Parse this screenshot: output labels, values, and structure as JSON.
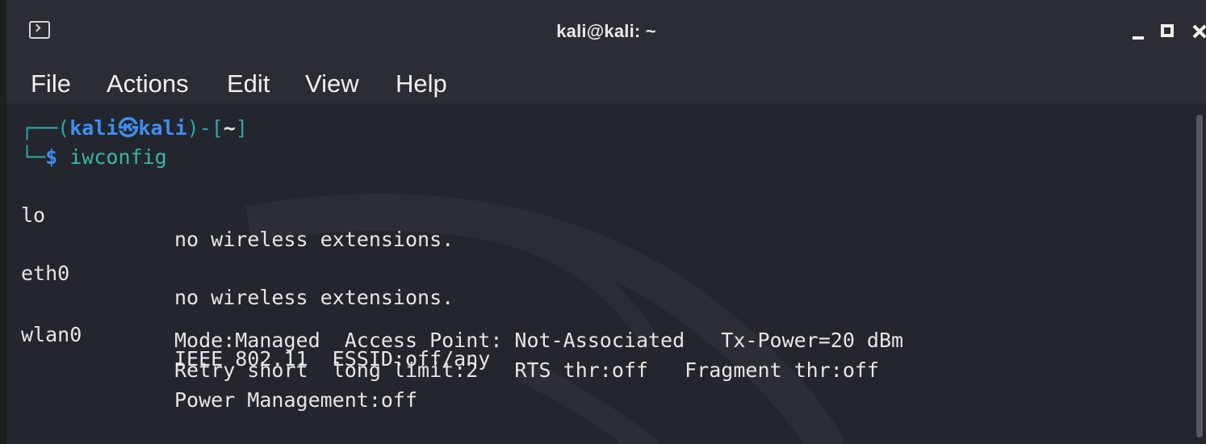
{
  "window": {
    "title": "kali@kali: ~",
    "icon": "terminal-icon"
  },
  "menu": {
    "items": [
      "File",
      "Actions",
      "Edit",
      "View",
      "Help"
    ]
  },
  "prompt": {
    "open": "┌──(",
    "user_host": "kali㉿kali",
    "sep": ")-[",
    "dir": "~",
    "close": "]",
    "corner": "└─",
    "dollar": "$",
    "command": "iwconfig"
  },
  "output": {
    "lo": {
      "iface": "lo",
      "text": "no wireless extensions."
    },
    "eth0": {
      "iface": "eth0",
      "text": "no wireless extensions."
    },
    "wlan0": {
      "iface": "wlan0",
      "lines": [
        "IEEE 802.11  ESSID:off/any",
        "Mode:Managed  Access Point: Not-Associated   Tx-Power=20 dBm",
        "Retry short  long limit:2   RTS thr:off   Fragment thr:off",
        "Power Management:off"
      ]
    }
  },
  "colors": {
    "background": "#23262d",
    "titlebar": "#2a2d33",
    "prompt_blue": "#3f8ef0",
    "command_teal": "#3ab6a6",
    "text": "#e6e6e6"
  }
}
